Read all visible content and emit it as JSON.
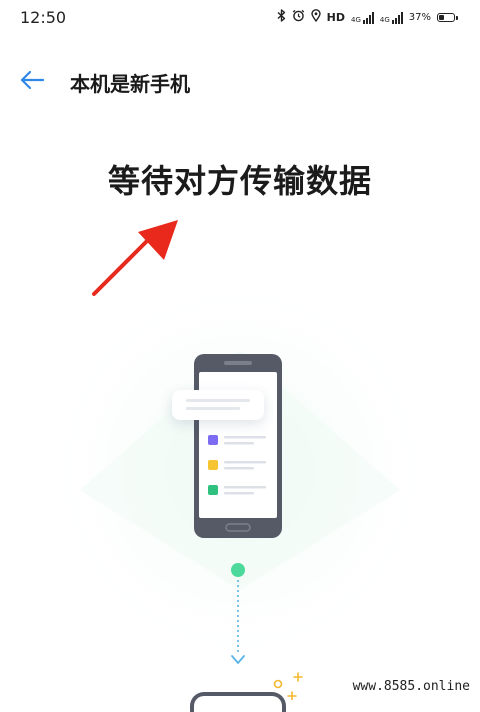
{
  "status_bar": {
    "time": "12:50",
    "hd_label": "HD",
    "network_labels": [
      "4G",
      "4G"
    ],
    "battery_percent_text": "37%",
    "battery_level": 0.37,
    "icons": [
      "bluetooth-icon",
      "alarm-icon",
      "location-icon",
      "signal-icon",
      "battery-icon"
    ]
  },
  "header": {
    "title": "本机是新手机",
    "back_icon": "arrow-left-icon"
  },
  "main": {
    "title": "等待对方传输数据"
  },
  "illustration": {
    "list_colors": [
      "#7c6cf2",
      "#f7c531",
      "#2ec27e"
    ],
    "accent_green": "#4cd99a",
    "accent_blue": "#5ab4e6",
    "sparkle_color": "#f5b82e"
  },
  "annotation": {
    "arrow_color": "#e8291c"
  },
  "watermark": "www.8585.online"
}
